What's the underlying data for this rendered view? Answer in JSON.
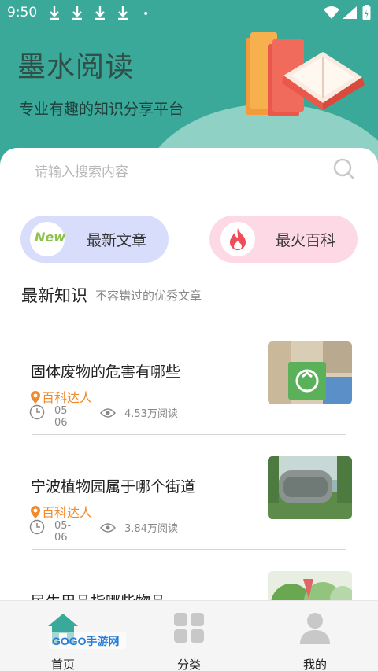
{
  "status_bar": {
    "time": "9:50",
    "dot": "•",
    "icons": [
      "download-icon",
      "download-icon",
      "download-icon",
      "download-icon",
      "wifi-icon",
      "signal-icon",
      "battery-icon"
    ]
  },
  "header": {
    "title": "墨水阅读",
    "subtitle": "专业有趣的知识分享平台"
  },
  "search": {
    "placeholder": "请输入搜索内容"
  },
  "quick_links": [
    {
      "label": "最新文章",
      "badge": "New",
      "color": "#d7ddfb"
    },
    {
      "label": "最火百科",
      "icon": "fire-icon",
      "color": "#fcd9e4"
    }
  ],
  "section": {
    "title": "最新知识",
    "subtitle": "不容错过的优秀文章"
  },
  "articles": [
    {
      "title": "固体废物的危害有哪些",
      "author": "百科达人",
      "date": "05-06",
      "views": "4.53万阅读"
    },
    {
      "title": "宁波植物园属于哪个街道",
      "author": "百科达人",
      "date": "05-06",
      "views": "3.84万阅读"
    },
    {
      "title": "民生用品指哪些物品",
      "author": "",
      "date": "",
      "views": ""
    }
  ],
  "bottom_nav": [
    {
      "label": "首页",
      "icon": "home-icon",
      "active": true
    },
    {
      "label": "分类",
      "icon": "grid-icon",
      "active": false
    },
    {
      "label": "我的",
      "icon": "user-icon",
      "active": false
    }
  ],
  "watermark": "GOGO手游网",
  "colors": {
    "header_bg": "#3aa99a",
    "accent_orange": "#f08a2b",
    "nav_active": "#3aa99a"
  }
}
